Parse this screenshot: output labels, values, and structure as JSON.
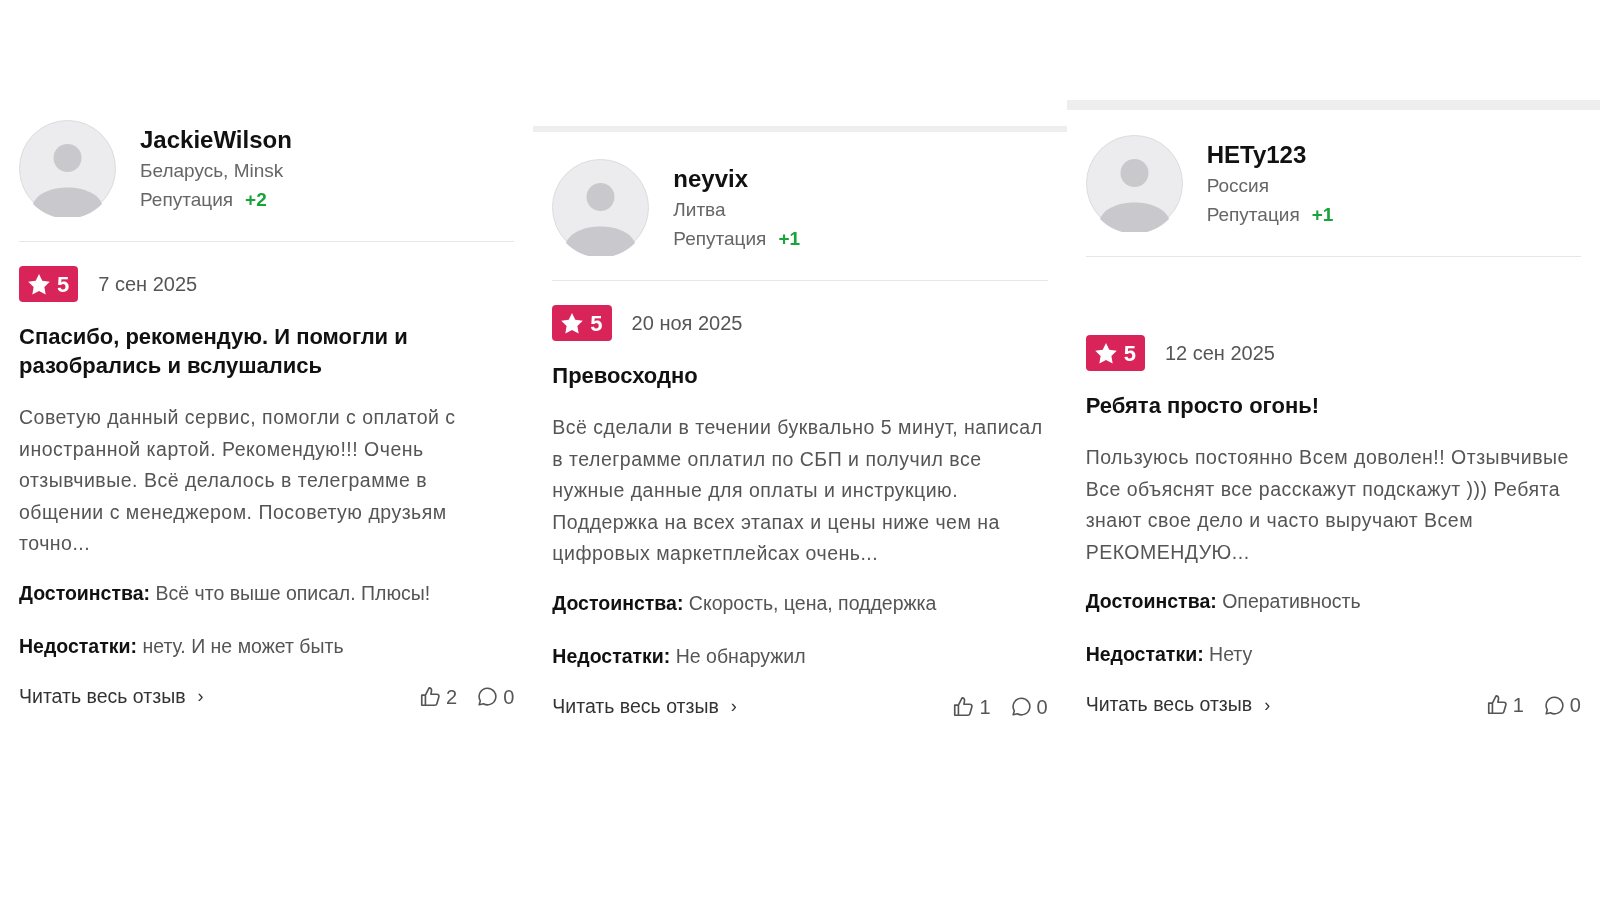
{
  "reviews": [
    {
      "author": "JackieWilson",
      "location": "Беларусь, Minsk",
      "reputation_label": "Репутация",
      "reputation": "+2",
      "rating": "5",
      "date": "7 сен 2025",
      "title": "Спасибо, рекомендую. И помогли и разобрались и вслушались",
      "text": "Советую данный сервис, помогли с оплатой с иностранной картой. Рекомендую!!! Очень отзывчивые. Всё делалось в телеграмме в общении с менеджером. Посоветую друзьям точно...",
      "pros_label": "Достоинства:",
      "pros": "Всё что выше описал. Плюсы!",
      "cons_label": "Недостатки:",
      "cons": "нету. И не может быть",
      "read_more": "Читать весь отзыв",
      "read_more_arrow": "›",
      "likes": "2",
      "comments": "0"
    },
    {
      "author": "neyvix",
      "location": "Литва",
      "reputation_label": "Репутация",
      "reputation": "+1",
      "rating": "5",
      "date": "20 ноя 2025",
      "title": "Превосходно",
      "text": "Всё сделали в течении буквально 5 минут, написал в телеграмме оплатил по СБП и получил все нужные данные для оплаты и инструкцию. Поддержка на всех этапах и цены ниже чем на цифровых маркетплейсах очень...",
      "pros_label": "Достоинства:",
      "pros": "Скорость, цена, поддержка",
      "cons_label": "Недостатки:",
      "cons": "Не обнаружил",
      "read_more": "Читать весь отзыв",
      "read_more_arrow": "›",
      "likes": "1",
      "comments": "0"
    },
    {
      "author": "HETy123",
      "location": "Россия",
      "reputation_label": "Репутация",
      "reputation": "+1",
      "rating": "5",
      "date": "12 сен 2025",
      "title": "Ребята просто огонь!",
      "text": "Пользуюсь постоянно Всем доволен!! Отзывчивые Все объяснят все расскажут подскажут ))) Ребята знают свое дело и часто выручают Всем РЕКОМЕНДУЮ...",
      "pros_label": "Достоинства:",
      "pros": "Оперативность",
      "cons_label": "Недостатки:",
      "cons": "Нету",
      "read_more": "Читать весь отзыв",
      "read_more_arrow": "›",
      "likes": "1",
      "comments": "0"
    }
  ]
}
